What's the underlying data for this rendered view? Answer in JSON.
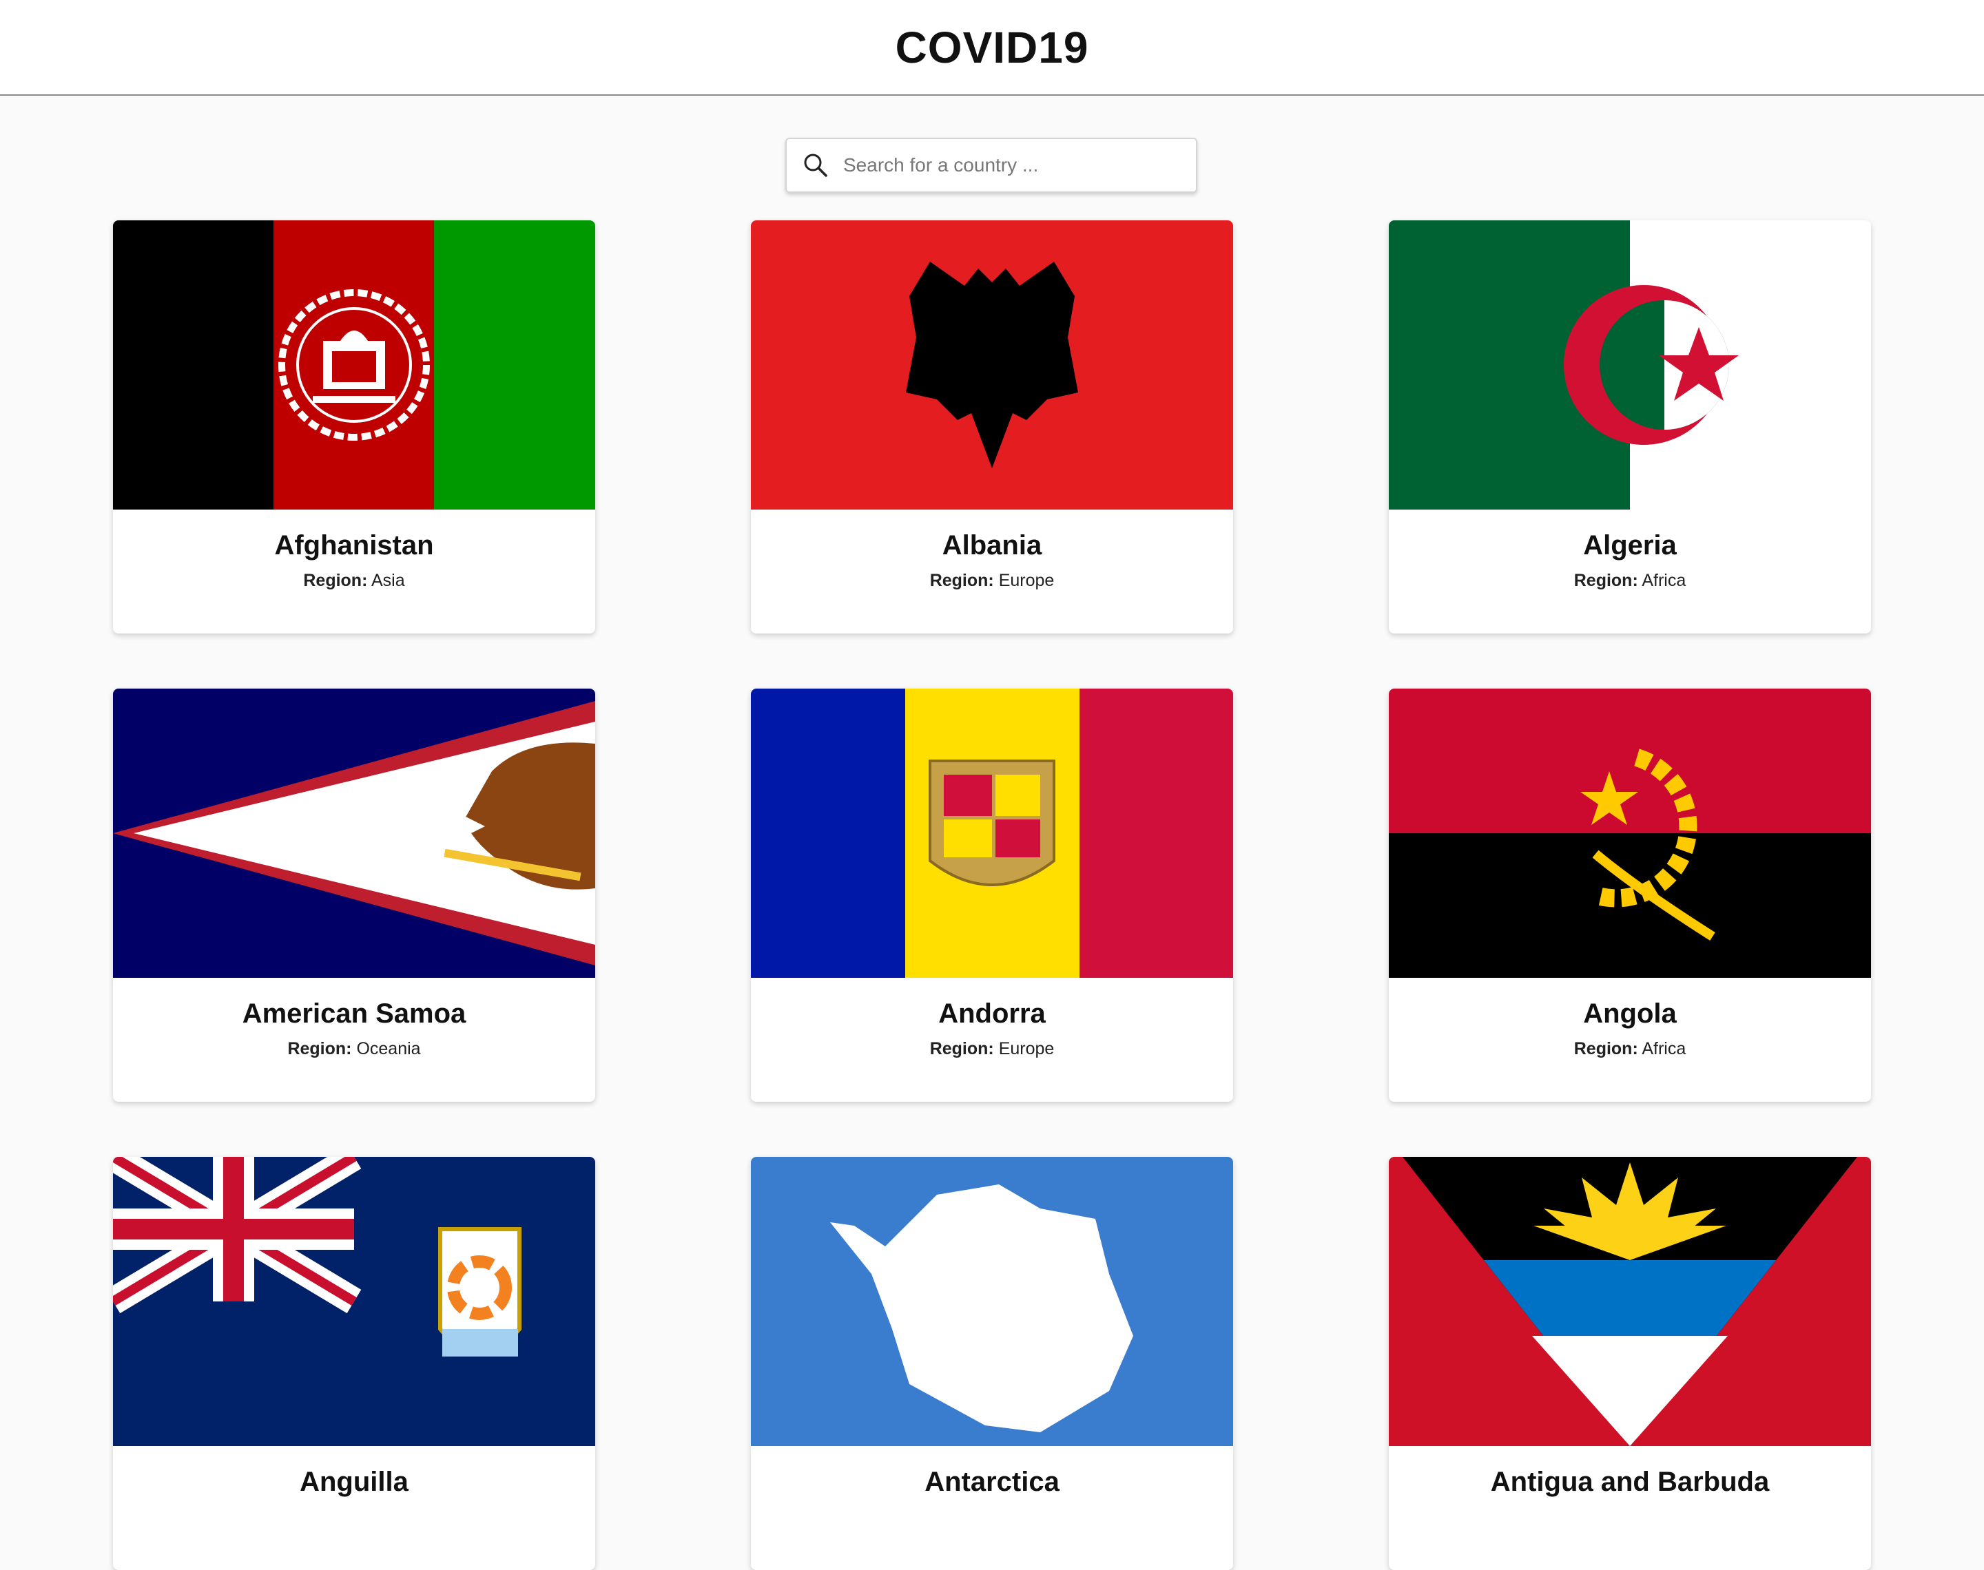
{
  "header": {
    "title": "COVID19"
  },
  "search": {
    "placeholder": "Search for a country ..."
  },
  "region_label": "Region:",
  "countries": [
    {
      "name": "Afghanistan",
      "region": "Asia",
      "flag_icon": "afghanistan-flag-icon"
    },
    {
      "name": "Albania",
      "region": "Europe",
      "flag_icon": "albania-flag-icon"
    },
    {
      "name": "Algeria",
      "region": "Africa",
      "flag_icon": "algeria-flag-icon"
    },
    {
      "name": "American Samoa",
      "region": "Oceania",
      "flag_icon": "american-samoa-flag-icon"
    },
    {
      "name": "Andorra",
      "region": "Europe",
      "flag_icon": "andorra-flag-icon"
    },
    {
      "name": "Angola",
      "region": "Africa",
      "flag_icon": "angola-flag-icon"
    },
    {
      "name": "Anguilla",
      "flag_icon": "anguilla-flag-icon"
    },
    {
      "name": "Antarctica",
      "flag_icon": "antarctica-flag-icon"
    },
    {
      "name": "Antigua and Barbuda",
      "flag_icon": "antigua-and-barbuda-flag-icon"
    }
  ],
  "colors": {
    "header_bg": "#ffffff",
    "page_bg": "#fafafa",
    "text": "#111111"
  }
}
